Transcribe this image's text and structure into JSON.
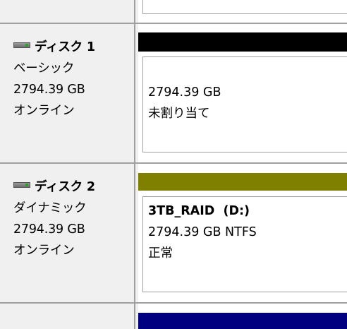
{
  "colors": {
    "unallocated_bar": "#000000",
    "dynamic_volume_bar": "#808000",
    "next_bar": "#000080"
  },
  "disks": [
    {
      "name": "ディスク 1",
      "type": "ベーシック",
      "size": "2794.39 GB",
      "status": "オンライン",
      "volume": {
        "size": "2794.39 GB",
        "state": "未割り当て"
      }
    },
    {
      "name": "ディスク 2",
      "type": "ダイナミック",
      "size": "2794.39 GB",
      "status": "オンライン",
      "volume": {
        "name": "3TB_RAID  (D:)",
        "size_fs": "2794.39 GB NTFS",
        "health": "正常"
      }
    }
  ]
}
